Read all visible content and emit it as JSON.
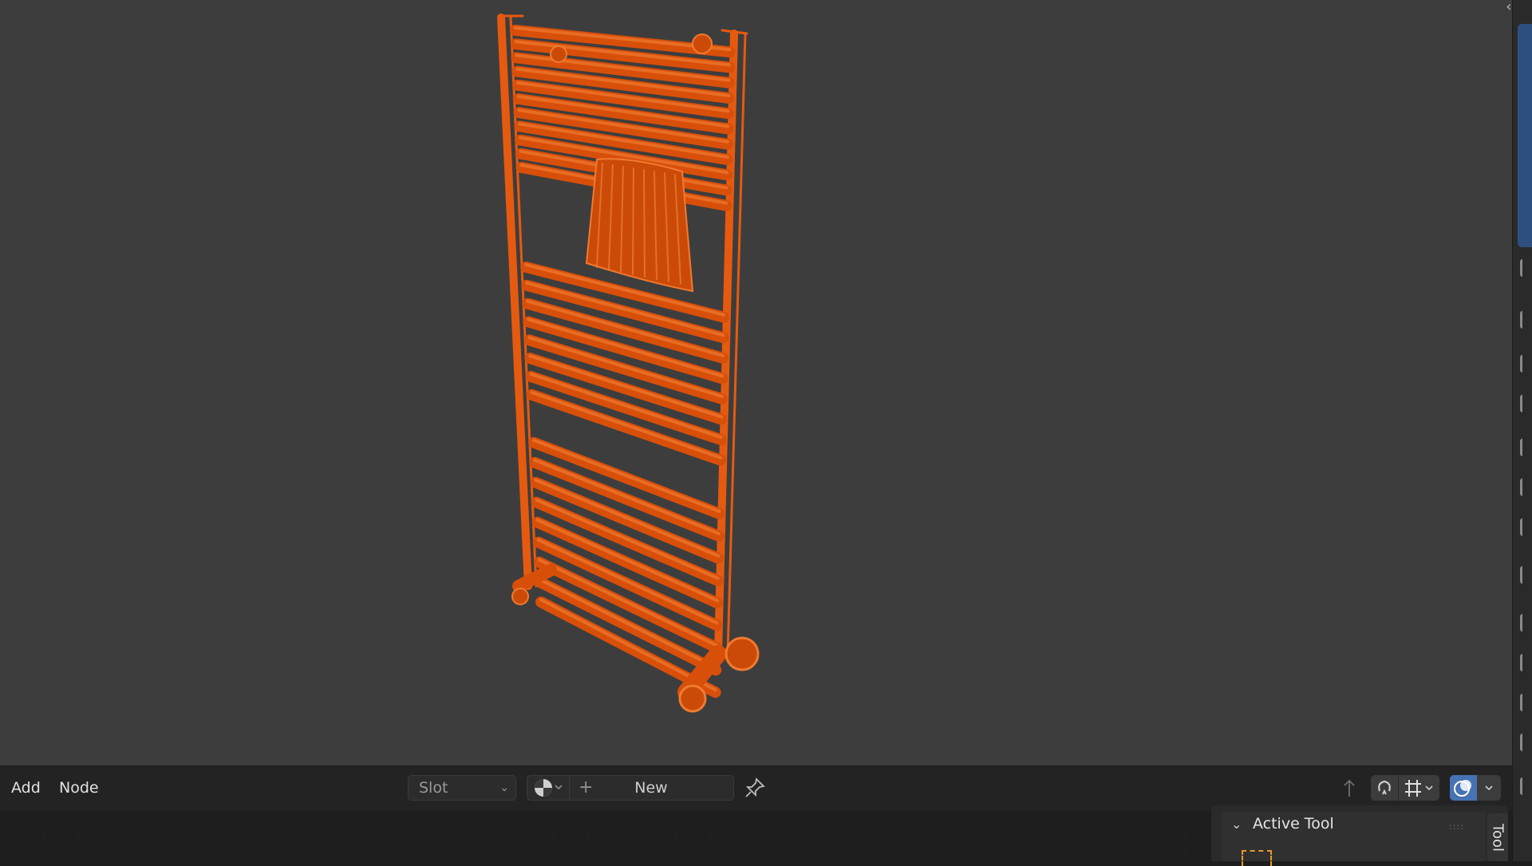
{
  "node_editor": {
    "menu": {
      "add": "Add",
      "node": "Node"
    },
    "slot": {
      "label": "Slot"
    },
    "material": {
      "new_label": "New",
      "browse_icon": "material-sphere-icon",
      "plus_icon": "plus-icon"
    },
    "pin_icon": "pin-icon"
  },
  "sidebar": {
    "active_tool": {
      "title": "Active Tool"
    },
    "tab_label": "Tool"
  },
  "colors": {
    "viewport_bg": "#3d3d3d",
    "selection_orange": "#e65a0f",
    "accent_blue": "#4772b3",
    "header_bg": "#232323"
  }
}
